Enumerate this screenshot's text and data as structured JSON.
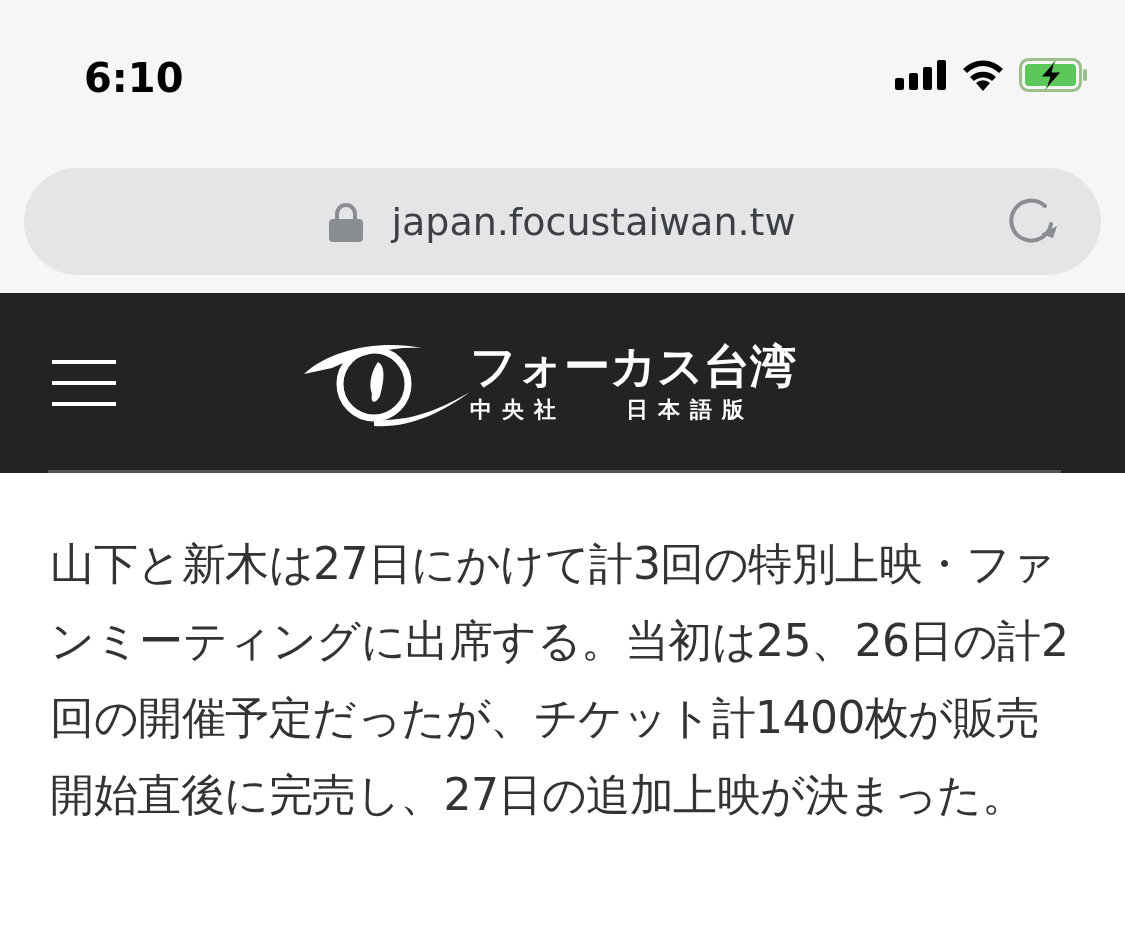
{
  "status_bar": {
    "time": "6:10",
    "battery_charging": true
  },
  "address_bar": {
    "url": "japan.focustaiwan.tw"
  },
  "header": {
    "logo_title": "フォーカス台湾",
    "logo_sub_left": "中央社",
    "logo_sub_right": "日本語版"
  },
  "article": {
    "paragraph": "山下と新木は27日にかけて計3回の特別上映・ファンミーティングに出席する。当初は25、26日の計2回の開催予定だったが、チケット計1400枚が販売開始直後に完売し、27日の追加上映が決まった。"
  }
}
